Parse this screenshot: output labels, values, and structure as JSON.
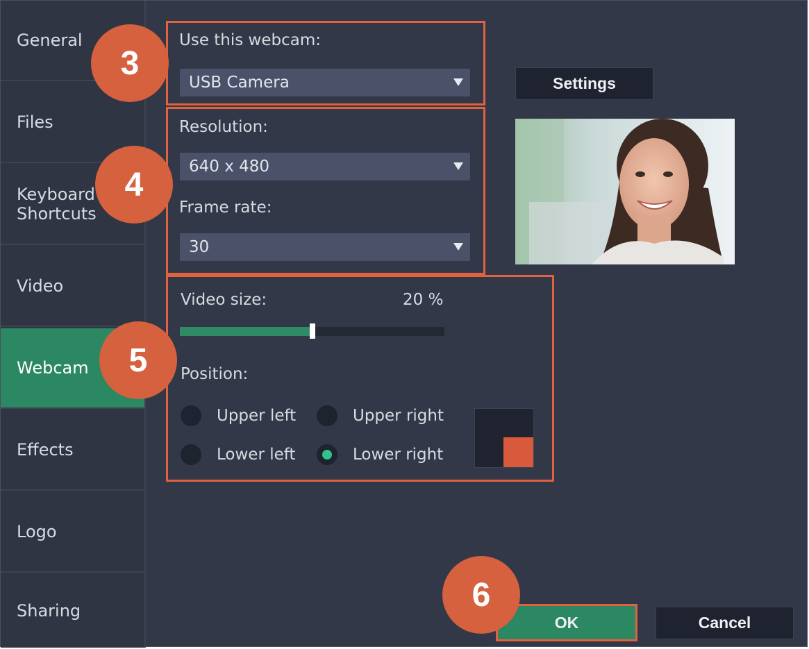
{
  "sidebar": {
    "items": [
      {
        "label": "General"
      },
      {
        "label": "Files"
      },
      {
        "label": "Keyboard\nShortcuts"
      },
      {
        "label": "Video"
      },
      {
        "label": "Webcam"
      },
      {
        "label": "Effects"
      },
      {
        "label": "Logo"
      },
      {
        "label": "Sharing"
      }
    ],
    "active": "Webcam"
  },
  "webcam": {
    "label": "Use this webcam:",
    "value": "USB Camera",
    "settings_button": "Settings"
  },
  "resolution": {
    "label": "Resolution:",
    "value": "640 x 480"
  },
  "frame_rate": {
    "label": "Frame rate:",
    "value": "30"
  },
  "video_size": {
    "label": "Video size:",
    "value_text": "20 %",
    "slider_fraction": 0.5
  },
  "position": {
    "label": "Position:",
    "options": [
      {
        "label": "Upper left",
        "selected": false
      },
      {
        "label": "Upper right",
        "selected": false
      },
      {
        "label": "Lower left",
        "selected": false
      },
      {
        "label": "Lower right",
        "selected": true
      }
    ]
  },
  "buttons": {
    "ok": "OK",
    "cancel": "Cancel"
  },
  "annotations": {
    "step3": "3",
    "step4": "4",
    "step5": "5",
    "step6": "6"
  },
  "colors": {
    "background": "#323847",
    "sidebar": "#2f3542",
    "accent_green": "#2b8862",
    "highlight_red": "#e0623f",
    "badge_orange": "#d5613f"
  },
  "preview": {
    "icon": "webcam-preview-image"
  }
}
